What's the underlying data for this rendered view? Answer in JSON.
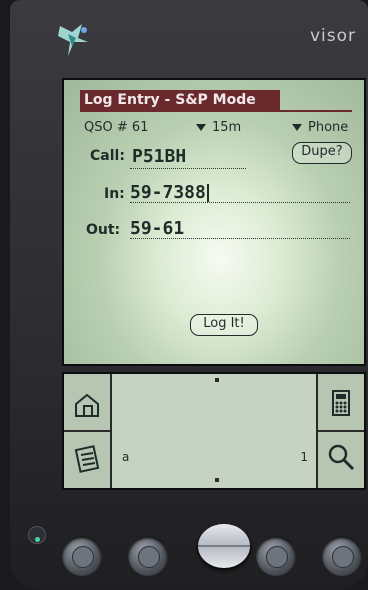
{
  "device": {
    "brand": "visor"
  },
  "app": {
    "title": "Log Entry - S&P Mode",
    "qso_label": "QSO #",
    "qso_number": "61",
    "band": "15m",
    "mode": "Phone",
    "fields": {
      "call_label": "Call:",
      "call_value": "P51BH",
      "in_label": "In:",
      "in_value": "59-7388",
      "out_label": "Out:",
      "out_value": "59-61"
    },
    "dupe_button": "Dupe?",
    "log_button": "Log It!"
  },
  "graffiti": {
    "left_hint": "a",
    "right_hint": "1",
    "icons": [
      "home-icon",
      "menu-icon",
      "calculator-icon",
      "find-icon"
    ]
  },
  "hardware_buttons": [
    "date-book-button",
    "address-button",
    "scroll-button",
    "todo-button",
    "memo-button"
  ],
  "colors": {
    "title_bar": "#6a2a2d",
    "screen": "#c6d7c0",
    "text": "#1f2d2a"
  }
}
